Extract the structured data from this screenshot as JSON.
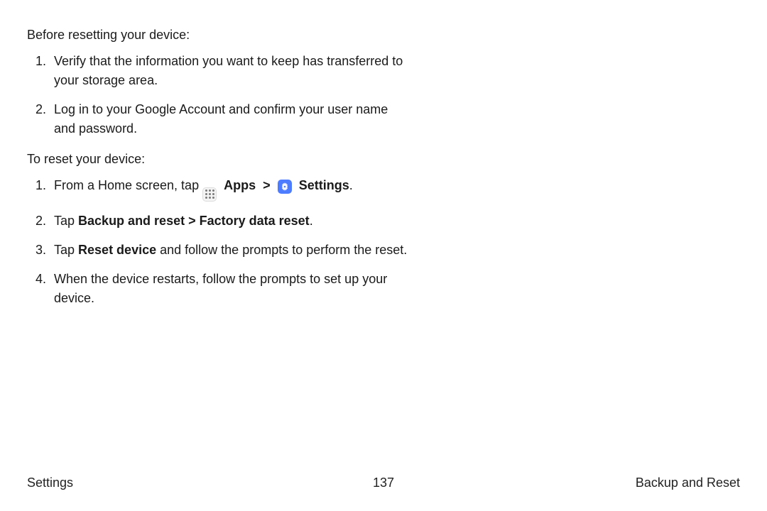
{
  "intro1": "Before resetting your device:",
  "pre": {
    "item1": "Verify that the information you want to keep has transferred to your storage area.",
    "item2": "Log in to your Google Account and confirm your user name and password."
  },
  "intro2": "To reset your device:",
  "reset": {
    "item1_pre": "From a Home screen, tap ",
    "apps_label": "Apps",
    "arrow": ">",
    "settings_label": "Settings",
    "item1_post": ".",
    "item2_pre": "Tap ",
    "item2_bold1": "Backup and reset",
    "item2_arrow": " > ",
    "item2_bold2": "Factory data reset",
    "item2_post": ".",
    "item3_pre": "Tap ",
    "item3_bold": "Reset device",
    "item3_post": " and follow the prompts to perform the reset.",
    "item4": "When the device restarts, follow the prompts to set up your device."
  },
  "footer": {
    "left": "Settings",
    "center": "137",
    "right": "Backup and Reset"
  }
}
